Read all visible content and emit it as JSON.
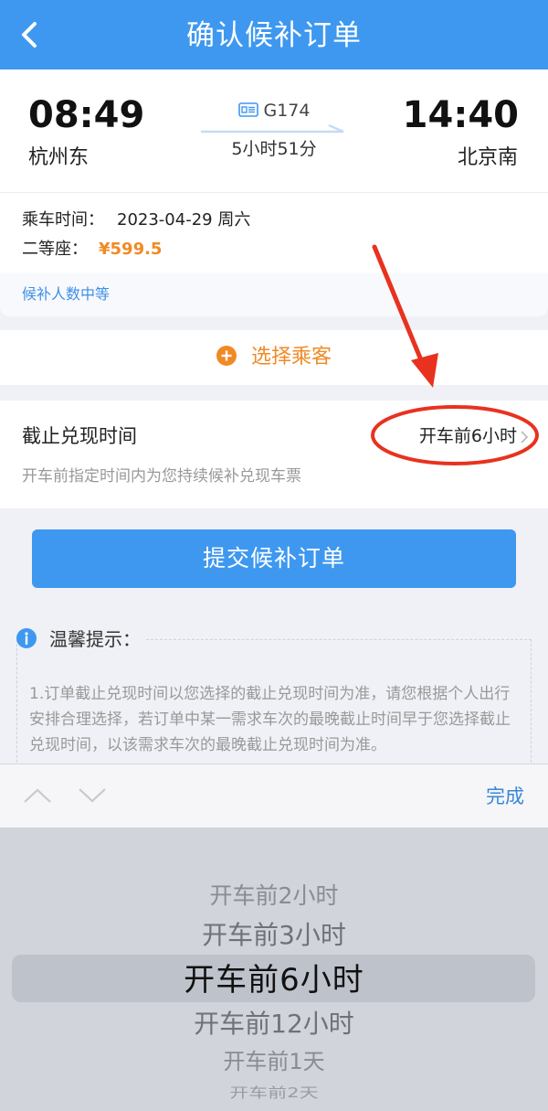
{
  "header": {
    "title": "确认候补订单"
  },
  "train": {
    "departure_time": "08:49",
    "departure_station": "杭州东",
    "arrival_time": "14:40",
    "arrival_station": "北京南",
    "train_number": "G174",
    "duration": "5小时51分"
  },
  "trip_info": {
    "date_label": "乘车时间：",
    "date_value": "2023-04-29 周六",
    "seat_label": "二等座：",
    "price": "¥599.5"
  },
  "queue_status": "候补人数中等",
  "select_passenger": {
    "label": "选择乘客",
    "icon": "plus-circle-icon",
    "color": "#f08a24"
  },
  "deadline": {
    "label": "截止兑现时间",
    "value": "开车前6小时",
    "description": "开车前指定时间内为您持续候补兑现车票"
  },
  "submit_button": "提交候补订单",
  "tips": {
    "title": "温馨提示：",
    "text": "1.订单截止兑现时间以您选择的截止兑现时间为准，请您根据个人出行安排合理选择，若订单中某一需求车次的最晚截止时间早于您选择截止兑现时间，以该需求车次的最晚截止兑现时间为准。"
  },
  "picker": {
    "done_label": "完成",
    "options": [
      "开车前2小时",
      "开车前3小时",
      "开车前6小时",
      "开车前12小时",
      "开车前1天",
      "开车前2天"
    ],
    "selected": "开车前6小时"
  },
  "colors": {
    "primary_blue": "#3e98f0",
    "accent_orange": "#f08a24",
    "annotation_red": "#e8321f"
  }
}
